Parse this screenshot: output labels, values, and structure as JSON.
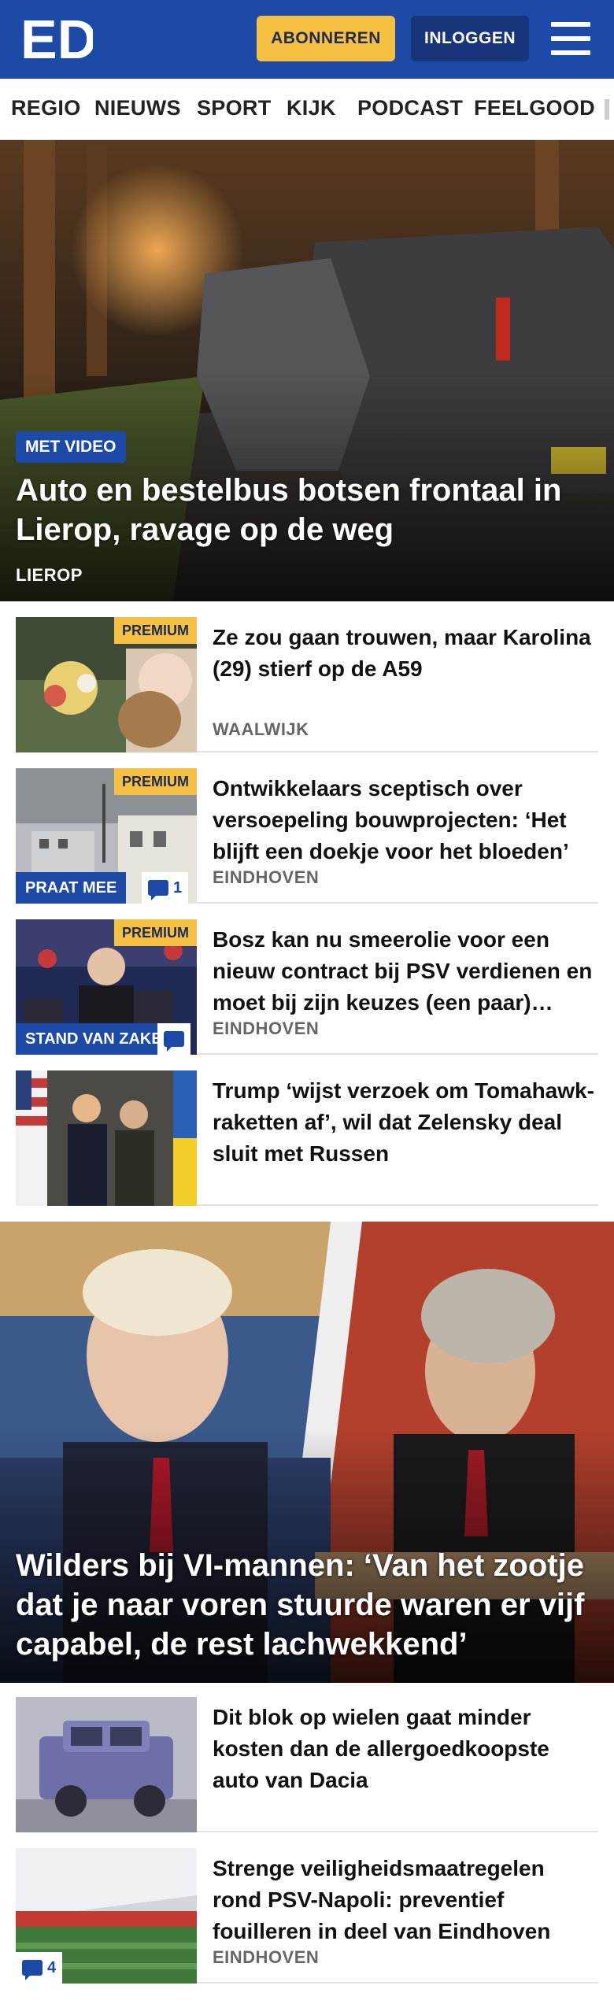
{
  "header": {
    "logo_text": "ED",
    "subscribe_label": "ABONNEREN",
    "login_label": "INLOGGEN",
    "brand_color": "#1e4aa7",
    "accent_color": "#f6c142"
  },
  "nav": {
    "items": [
      "REGIO",
      "NIEUWS",
      "SPORT",
      "KIJK",
      "PODCAST",
      "FEELGOOD"
    ]
  },
  "hero": {
    "badge": "MET VIDEO",
    "title": "Auto en bestelbus botsen frontaal in Lierop, ravage op de weg",
    "location": "LIEROP"
  },
  "articles": [
    {
      "premium": "PREMIUM",
      "title": "Ze zou gaan trouwen, maar Karolina (29) stierf op de A59",
      "location": "WAALWIJK",
      "tag": "",
      "comments": ""
    },
    {
      "premium": "PREMIUM",
      "title": "Ontwikkelaars sceptisch over versoepeling bouwprojecten: ‘Het blijft een doekje voor het bloeden’",
      "location": "EINDHOVEN",
      "tag": "PRAAT MEE",
      "comments": "1"
    },
    {
      "premium": "PREMIUM",
      "title": "Bosz kan nu smeerolie voor een nieuw contract bij PSV verdienen en moet bij zijn keuzes (een paar) risico’s nemen",
      "location": "EINDHOVEN",
      "tag": "STAND VAN ZAKEN",
      "comments": ""
    },
    {
      "premium": "",
      "title": "Trump ‘wijst verzoek om Tomahawk-raketten af’, wil dat Zelensky deal sluit met Russen",
      "location": "",
      "tag": "",
      "comments": ""
    }
  ],
  "feature": {
    "title": "Wilders bij VI-mannen: ‘Van het zootje dat je naar voren stuurde waren er vijf capabel, de rest lachwekkend’"
  },
  "articles2": [
    {
      "title": "Dit blok op wielen gaat minder kosten dan de allergoedkoopste auto van Dacia",
      "location": "",
      "comments": ""
    },
    {
      "title": "Strenge veiligheidsmaatregelen rond PSV-Napoli: preventief fouilleren in deel van Eindhoven",
      "location": "EINDHOVEN",
      "comments": "4"
    }
  ]
}
